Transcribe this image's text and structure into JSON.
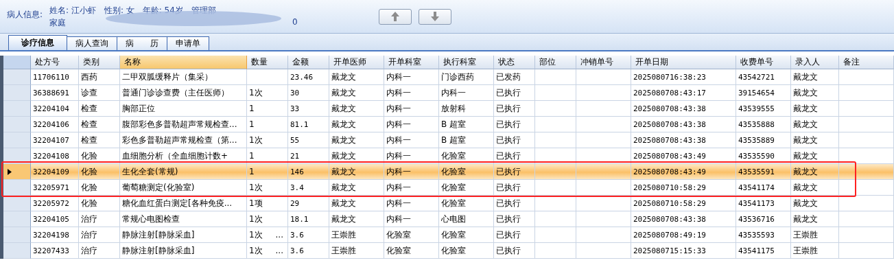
{
  "patient": {
    "label": "病人信息:",
    "line1": [
      "姓名: 江小虾",
      "性别: 女",
      "年龄: 54岁",
      "管理部"
    ],
    "line2": [
      "家庭",
      "0"
    ]
  },
  "nav_buttons": [
    {
      "kind": "up"
    },
    {
      "kind": "down"
    }
  ],
  "tabs": [
    {
      "label": "诊疗信息",
      "selected": true
    },
    {
      "label": "病人查询",
      "selected": false
    },
    {
      "label": "病　　历",
      "selected": false
    },
    {
      "label": "申请单",
      "selected": false
    }
  ],
  "table": {
    "columns": [
      {
        "label": "处方号",
        "selected": false
      },
      {
        "label": "类别",
        "selected": false
      },
      {
        "label": "名称",
        "selected": true
      },
      {
        "label": "数量",
        "selected": false
      },
      {
        "label": "金额",
        "selected": false
      },
      {
        "label": "开单医师",
        "selected": false
      },
      {
        "label": "开单科室",
        "selected": false
      },
      {
        "label": "执行科室",
        "selected": false
      },
      {
        "label": "状态",
        "selected": false
      },
      {
        "label": "部位",
        "selected": false
      },
      {
        "label": "冲销单号",
        "selected": false
      },
      {
        "label": "开单日期",
        "selected": false
      },
      {
        "label": "收费单号",
        "selected": false
      },
      {
        "label": "录入人",
        "selected": false
      },
      {
        "label": "备注",
        "selected": false
      }
    ],
    "rows": [
      {
        "selected": false,
        "cells": [
          "11706110",
          "西药",
          "二甲双胍缓释片（集采）",
          null,
          "23.46",
          "戴龙文",
          "内科一",
          "门诊西药",
          "已发药",
          null,
          null,
          "2025080716:38:23",
          "43542721",
          "戴龙文",
          null
        ]
      },
      {
        "selected": false,
        "cells": [
          "36388691",
          "诊查",
          "普通门诊诊查费（主任医师）",
          "1次",
          "30",
          "戴龙文",
          "内科一",
          "内科一",
          "已执行",
          null,
          null,
          "2025080708:43:17",
          "39154654",
          "戴龙文",
          null
        ]
      },
      {
        "selected": false,
        "cells": [
          "32204104",
          "检查",
          "胸部正位",
          "1",
          "33",
          "戴龙文",
          "内科一",
          "放射科",
          "已执行",
          null,
          null,
          "2025080708:43:38",
          "43539555",
          "戴龙文",
          null
        ]
      },
      {
        "selected": false,
        "cells": [
          "32204106",
          "检查",
          "腹部彩色多普勒超声常规检查...",
          "1",
          "81.1",
          "戴龙文",
          "内科一",
          "B 超室",
          "已执行",
          null,
          null,
          "2025080708:43:38",
          "43535888",
          "戴龙文",
          null
        ]
      },
      {
        "selected": false,
        "cells": [
          "32204107",
          "检查",
          "彩色多普勒超声常规检查（第...",
          "1次",
          "55",
          "戴龙文",
          "内科一",
          "B 超室",
          "已执行",
          null,
          null,
          "2025080708:43:38",
          "43535889",
          "戴龙文",
          null
        ]
      },
      {
        "selected": false,
        "cells": [
          "32204108",
          "化验",
          "血细胞分析（全血细胞计数+",
          "1",
          "21",
          "戴龙文",
          "内科一",
          "化验室",
          "已执行",
          null,
          null,
          "2025080708:43:49",
          "43535590",
          "戴龙文",
          null
        ]
      },
      {
        "selected": true,
        "cells": [
          "32204109",
          "化验",
          "生化全套(常规)",
          "1",
          "146",
          "戴龙文",
          "内科一",
          "化验室",
          "已执行",
          null,
          null,
          "2025080708:43:49",
          "43535591",
          "戴龙文",
          null
        ]
      },
      {
        "selected": false,
        "cells": [
          "32205971",
          "化验",
          "葡萄糖测定(化验室)",
          "1次",
          "3.4",
          "戴龙文",
          "内科一",
          "化验室",
          "已执行",
          null,
          null,
          "2025080710:58:29",
          "43541174",
          "戴龙文",
          null
        ]
      },
      {
        "selected": false,
        "cells": [
          "32205972",
          "化验",
          "糖化血红蛋白测定[各种免疫...",
          "1项",
          "29",
          "戴龙文",
          "内科一",
          "化验室",
          "已执行",
          null,
          null,
          "2025080710:58:29",
          "43541173",
          "戴龙文",
          null
        ]
      },
      {
        "selected": false,
        "cells": [
          "32204105",
          "治疗",
          "常规心电图检查",
          "1次",
          "18.1",
          "戴龙文",
          "内科一",
          "心电图",
          "已执行",
          null,
          null,
          "2025080708:43:38",
          "43536716",
          "戴龙文",
          null
        ]
      },
      {
        "selected": false,
        "qty_more": "...",
        "cells": [
          "32204198",
          "治疗",
          "静脉注射[静脉采血]",
          "1次",
          "3.6",
          "王崇胜",
          "化验室",
          "化验室",
          "已执行",
          null,
          null,
          "2025080708:49:19",
          "43535593",
          "王崇胜",
          null
        ]
      },
      {
        "selected": false,
        "qty_more": "...",
        "cells": [
          "32207433",
          "治疗",
          "静脉注射[静脉采血]",
          "1次",
          "3.6",
          "王崇胜",
          "化验室",
          "化验室",
          "已执行",
          null,
          null,
          "2025080715:15:33",
          "43541175",
          "王崇胜",
          null
        ]
      }
    ]
  }
}
